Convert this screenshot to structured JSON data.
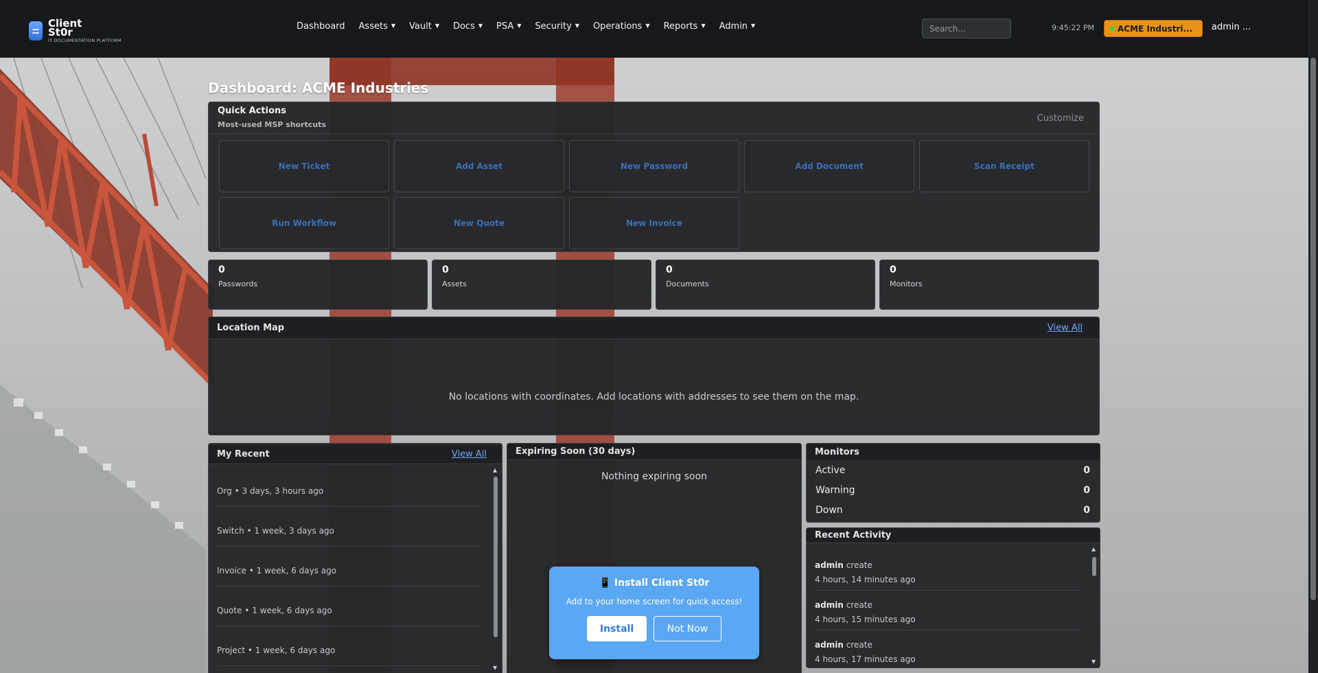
{
  "brand": {
    "name": "Client St0r",
    "tagline": "IT DOCUMENTATION PLATFORM"
  },
  "nav": {
    "items": [
      {
        "label": "Dashboard",
        "dropdown": false
      },
      {
        "label": "Assets",
        "dropdown": true
      },
      {
        "label": "Vault",
        "dropdown": true
      },
      {
        "label": "Docs",
        "dropdown": true
      },
      {
        "label": "PSA",
        "dropdown": true
      },
      {
        "label": "Security",
        "dropdown": true
      },
      {
        "label": "Operations",
        "dropdown": true
      },
      {
        "label": "Reports",
        "dropdown": true
      },
      {
        "label": "Admin",
        "dropdown": true
      }
    ],
    "search_placeholder": "Search...",
    "clock": "9:45:22 PM",
    "org": "ACME Industri...",
    "user": "admin ..."
  },
  "page": {
    "title": "Dashboard: ACME Industries"
  },
  "quick_actions": {
    "title": "Quick Actions",
    "subtitle": "Most-used MSP shortcuts",
    "customize": "Customize",
    "buttons": [
      "New Ticket",
      "Add Asset",
      "New Password",
      "Add Document",
      "Scan Receipt",
      "Run Workflow",
      "New Quote",
      "New Invoice"
    ]
  },
  "stats": [
    {
      "value": "0",
      "label": "Passwords"
    },
    {
      "value": "0",
      "label": "Assets"
    },
    {
      "value": "0",
      "label": "Documents"
    },
    {
      "value": "0",
      "label": "Monitors"
    }
  ],
  "location_map": {
    "title": "Location Map",
    "view_all": "View All",
    "empty": "No locations with coordinates. Add locations with addresses to see them on the map."
  },
  "my_recent": {
    "title": "My Recent",
    "view_all": "View All",
    "items": [
      "Org • 3 days, 3 hours ago",
      "Switch • 1 week, 3 days ago",
      "Invoice • 1 week, 6 days ago",
      "Quote • 1 week, 6 days ago",
      "Project • 1 week, 6 days ago"
    ]
  },
  "expiring": {
    "title": "Expiring Soon (30 days)",
    "empty": "Nothing expiring soon"
  },
  "monitors": {
    "title": "Monitors",
    "rows": [
      {
        "label": "Active",
        "value": "0"
      },
      {
        "label": "Warning",
        "value": "0"
      },
      {
        "label": "Down",
        "value": "0"
      }
    ]
  },
  "recent_activity": {
    "title": "Recent Activity",
    "items": [
      {
        "user": "admin",
        "action": "create",
        "time": "4 hours, 14 minutes ago"
      },
      {
        "user": "admin",
        "action": "create",
        "time": "4 hours, 15 minutes ago"
      },
      {
        "user": "admin",
        "action": "create",
        "time": "4 hours, 17 minutes ago"
      }
    ]
  },
  "install_prompt": {
    "icon": "📱",
    "title": "Install Client St0r",
    "message": "Add to your home screen for quick access!",
    "install_label": "Install",
    "dismiss_label": "Not Now"
  },
  "colors": {
    "accent": "#6ea8ff",
    "org_badge": "#e8921a",
    "install_bg": "#5aa7f3",
    "navbar": "#16181c"
  }
}
